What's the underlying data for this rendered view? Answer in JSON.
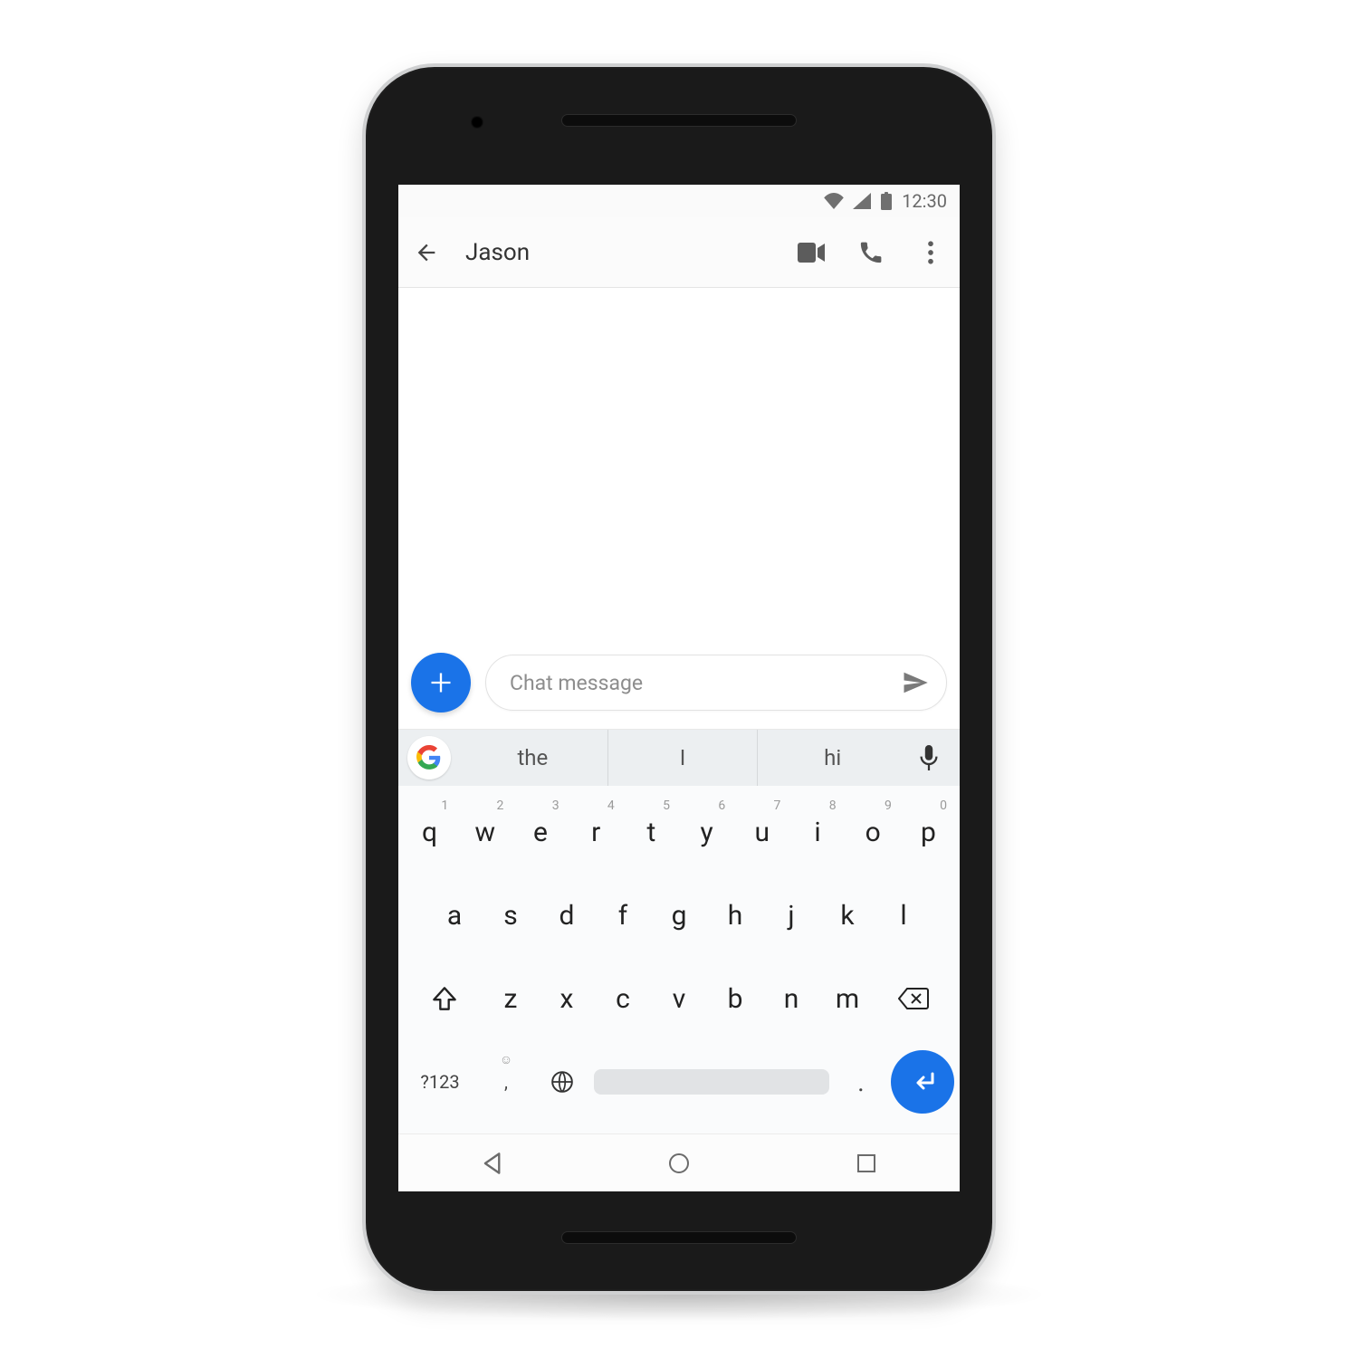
{
  "status": {
    "time": "12:30"
  },
  "appbar": {
    "contact_name": "Jason"
  },
  "compose": {
    "placeholder": "Chat message"
  },
  "keyboard": {
    "suggestions": [
      "the",
      "I",
      "hi"
    ],
    "row1": [
      {
        "k": "q",
        "h": "1"
      },
      {
        "k": "w",
        "h": "2"
      },
      {
        "k": "e",
        "h": "3"
      },
      {
        "k": "r",
        "h": "4"
      },
      {
        "k": "t",
        "h": "5"
      },
      {
        "k": "y",
        "h": "6"
      },
      {
        "k": "u",
        "h": "7"
      },
      {
        "k": "i",
        "h": "8"
      },
      {
        "k": "o",
        "h": "9"
      },
      {
        "k": "p",
        "h": "0"
      }
    ],
    "row2": [
      "a",
      "s",
      "d",
      "f",
      "g",
      "h",
      "j",
      "k",
      "l"
    ],
    "row3": [
      "z",
      "x",
      "c",
      "v",
      "b",
      "n",
      "m"
    ],
    "symbols_label": "?123",
    "comma_label": ",",
    "period_label": "."
  }
}
